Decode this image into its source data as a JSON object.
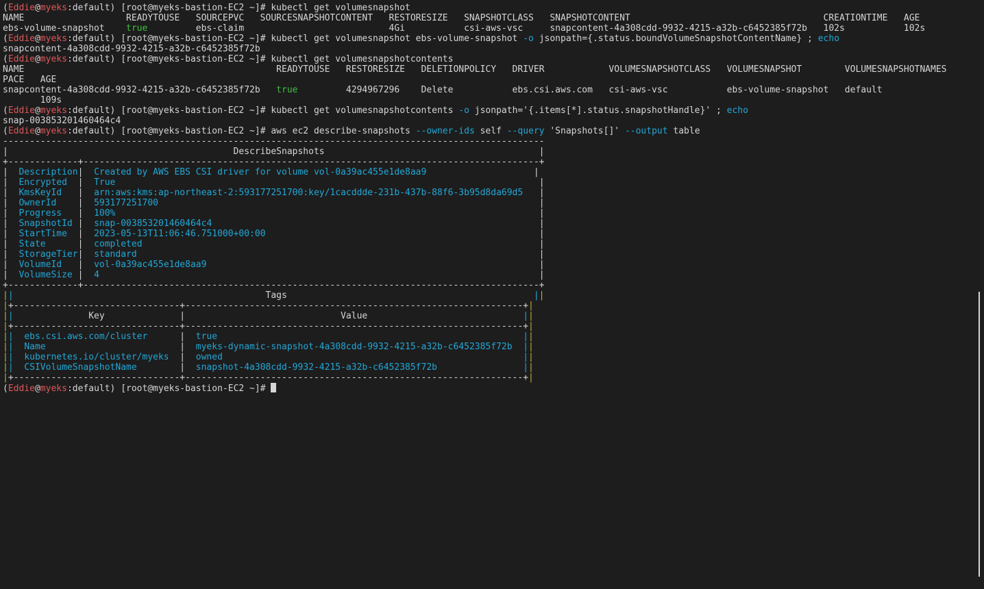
{
  "terminal": {
    "prompt": {
      "user": "Eddie",
      "cluster": "myeks",
      "namespace": "default",
      "host": "[root@myeks-bastion-EC2 ~]#"
    },
    "lines": [
      [
        {
          "t": "(",
          "c": "def"
        },
        {
          "t": "Eddie",
          "c": "red"
        },
        {
          "t": "@",
          "c": "def"
        },
        {
          "t": "myeks",
          "c": "red"
        },
        {
          "t": ":default) [root@myeks-bastion-EC2 ~]# kubectl get volumesnapshot",
          "c": "def"
        }
      ],
      [
        {
          "t": "NAME                   READYTOUSE   SOURCEPVC   SOURCESNAPSHOTCONTENT   RESTORESIZE   SNAPSHOTCLASS   SNAPSHOTCONTENT                                    CREATIONTIME   AGE",
          "c": "def"
        }
      ],
      [
        {
          "t": "ebs-volume-snapshot    ",
          "c": "def"
        },
        {
          "t": "true",
          "c": "green"
        },
        {
          "t": "         ebs-claim                           4Gi           csi-aws-vsc     snapcontent-4a308cdd-9932-4215-a32b-c6452385f72b   102s           102s",
          "c": "def"
        }
      ],
      [
        {
          "t": "(",
          "c": "def"
        },
        {
          "t": "Eddie",
          "c": "red"
        },
        {
          "t": "@",
          "c": "def"
        },
        {
          "t": "myeks",
          "c": "red"
        },
        {
          "t": ":default) [root@myeks-bastion-EC2 ~]# kubectl get volumesnapshot ebs-volume-snapshot ",
          "c": "def"
        },
        {
          "t": "-o",
          "c": "cyan"
        },
        {
          "t": " jsonpath={.status.boundVolumeSnapshotContentName} ; ",
          "c": "def"
        },
        {
          "t": "echo",
          "c": "cyan"
        }
      ],
      [
        {
          "t": "snapcontent-4a308cdd-9932-4215-a32b-c6452385f72b",
          "c": "def"
        }
      ],
      [
        {
          "t": "(",
          "c": "def"
        },
        {
          "t": "Eddie",
          "c": "red"
        },
        {
          "t": "@",
          "c": "def"
        },
        {
          "t": "myeks",
          "c": "red"
        },
        {
          "t": ":default) [root@myeks-bastion-EC2 ~]# kubectl get volumesnapshotcontents",
          "c": "def"
        }
      ],
      [
        {
          "t": "NAME                                               READYTOUSE   RESTORESIZE   DELETIONPOLICY   DRIVER            VOLUMESNAPSHOTCLASS   VOLUMESNAPSHOT        VOLUMESNAPSHOTNAMES",
          "c": "def"
        }
      ],
      [
        {
          "t": "PACE   AGE",
          "c": "def"
        }
      ],
      [
        {
          "t": "snapcontent-4a308cdd-9932-4215-a32b-c6452385f72b   ",
          "c": "def"
        },
        {
          "t": "true",
          "c": "green"
        },
        {
          "t": "         4294967296    Delete           ebs.csi.aws.com   csi-aws-vsc           ebs-volume-snapshot   default",
          "c": "def"
        }
      ],
      [
        {
          "t": "       109s",
          "c": "def"
        }
      ],
      [
        {
          "t": "(",
          "c": "def"
        },
        {
          "t": "Eddie",
          "c": "red"
        },
        {
          "t": "@",
          "c": "def"
        },
        {
          "t": "myeks",
          "c": "red"
        },
        {
          "t": ":default) [root@myeks-bastion-EC2 ~]# kubectl get volumesnapshotcontents ",
          "c": "def"
        },
        {
          "t": "-o",
          "c": "cyan"
        },
        {
          "t": " jsonpath='{.items[*].status.snapshotHandle}' ; ",
          "c": "def"
        },
        {
          "t": "echo",
          "c": "cyan"
        }
      ],
      [
        {
          "t": "snap-003853201460464c4",
          "c": "def"
        }
      ],
      [
        {
          "t": "(",
          "c": "def"
        },
        {
          "t": "Eddie",
          "c": "red"
        },
        {
          "t": "@",
          "c": "def"
        },
        {
          "t": "myeks",
          "c": "red"
        },
        {
          "t": ":default) [root@myeks-bastion-EC2 ~]# aws ec2 describe-snapshots ",
          "c": "def"
        },
        {
          "t": "--owner-ids",
          "c": "cyan"
        },
        {
          "t": " self ",
          "c": "def"
        },
        {
          "t": "--query",
          "c": "cyan"
        },
        {
          "t": " 'Snapshots[]' ",
          "c": "def"
        },
        {
          "t": "--output",
          "c": "cyan"
        },
        {
          "t": " table",
          "c": "def"
        }
      ],
      [
        {
          "t": "-----------------------------------------------------------------------------------------------------",
          "c": "def"
        }
      ],
      [
        {
          "t": "|                                          DescribeSnapshots                                        |",
          "c": "def"
        }
      ],
      [
        {
          "t": "+-------------+-------------------------------------------------------------------------------------+",
          "c": "def"
        }
      ],
      [
        {
          "t": "|  ",
          "c": "def"
        },
        {
          "t": "Description",
          "c": "cyan"
        },
        {
          "t": "|  ",
          "c": "def"
        },
        {
          "t": "Created by AWS EBS CSI driver for volume vol-0a39ac455e1de8aa9",
          "c": "cyan"
        },
        {
          "t": "                    |",
          "c": "def"
        }
      ],
      [
        {
          "t": "|  ",
          "c": "def"
        },
        {
          "t": "Encrypted",
          "c": "cyan"
        },
        {
          "t": "  |  ",
          "c": "def"
        },
        {
          "t": "True",
          "c": "cyan"
        },
        {
          "t": "                                                                               |",
          "c": "def"
        }
      ],
      [
        {
          "t": "|  ",
          "c": "def"
        },
        {
          "t": "KmsKeyId",
          "c": "cyan"
        },
        {
          "t": "   |  ",
          "c": "def"
        },
        {
          "t": "arn:aws:kms:ap-northeast-2:593177251700:key/1cacddde-231b-437b-88f6-3b95d8da69d5",
          "c": "cyan"
        },
        {
          "t": "   |",
          "c": "def"
        }
      ],
      [
        {
          "t": "|  ",
          "c": "def"
        },
        {
          "t": "OwnerId",
          "c": "cyan"
        },
        {
          "t": "    |  ",
          "c": "def"
        },
        {
          "t": "593177251700",
          "c": "cyan"
        },
        {
          "t": "                                                                       |",
          "c": "def"
        }
      ],
      [
        {
          "t": "|  ",
          "c": "def"
        },
        {
          "t": "Progress",
          "c": "cyan"
        },
        {
          "t": "   |  ",
          "c": "def"
        },
        {
          "t": "100%",
          "c": "cyan"
        },
        {
          "t": "                                                                               |",
          "c": "def"
        }
      ],
      [
        {
          "t": "|  ",
          "c": "def"
        },
        {
          "t": "SnapshotId",
          "c": "cyan"
        },
        {
          "t": " |  ",
          "c": "def"
        },
        {
          "t": "snap-003853201460464c4",
          "c": "cyan"
        },
        {
          "t": "                                                             |",
          "c": "def"
        }
      ],
      [
        {
          "t": "|  ",
          "c": "def"
        },
        {
          "t": "StartTime",
          "c": "cyan"
        },
        {
          "t": "  |  ",
          "c": "def"
        },
        {
          "t": "2023-05-13T11:06:46.751000+00:00",
          "c": "cyan"
        },
        {
          "t": "                                                   |",
          "c": "def"
        }
      ],
      [
        {
          "t": "|  ",
          "c": "def"
        },
        {
          "t": "State",
          "c": "cyan"
        },
        {
          "t": "      |  ",
          "c": "def"
        },
        {
          "t": "completed",
          "c": "cyan"
        },
        {
          "t": "                                                                          |",
          "c": "def"
        }
      ],
      [
        {
          "t": "|  ",
          "c": "def"
        },
        {
          "t": "StorageTier",
          "c": "cyan"
        },
        {
          "t": "|  ",
          "c": "def"
        },
        {
          "t": "standard",
          "c": "cyan"
        },
        {
          "t": "                                                                           |",
          "c": "def"
        }
      ],
      [
        {
          "t": "|  ",
          "c": "def"
        },
        {
          "t": "VolumeId",
          "c": "cyan"
        },
        {
          "t": "   |  ",
          "c": "def"
        },
        {
          "t": "vol-0a39ac455e1de8aa9",
          "c": "cyan"
        },
        {
          "t": "                                                              |",
          "c": "def"
        }
      ],
      [
        {
          "t": "|  ",
          "c": "def"
        },
        {
          "t": "VolumeSize",
          "c": "cyan"
        },
        {
          "t": " |  ",
          "c": "def"
        },
        {
          "t": "4",
          "c": "cyan"
        },
        {
          "t": "                                                                                  |",
          "c": "def"
        }
      ],
      [
        {
          "t": "+-------------+-------------------------------------------------------------------------------------+",
          "c": "def"
        }
      ],
      [
        {
          "t": "|",
          "c": "yel"
        },
        {
          "t": "|",
          "c": "cyan"
        },
        {
          "t": "                                               Tags                                              ",
          "c": "def"
        },
        {
          "t": "|",
          "c": "cyan"
        },
        {
          "t": "|",
          "c": "yel"
        }
      ],
      [
        {
          "t": "|",
          "c": "yel"
        },
        {
          "t": "+-------------------------------+---------------------------------------------------------------+",
          "c": "def"
        },
        {
          "t": "|",
          "c": "yel"
        }
      ],
      [
        {
          "t": "|",
          "c": "yel"
        },
        {
          "t": "|",
          "c": "cyan"
        },
        {
          "t": "              Key              |                             Value                             ",
          "c": "def"
        },
        {
          "t": "|",
          "c": "cyan"
        },
        {
          "t": "|",
          "c": "yel"
        }
      ],
      [
        {
          "t": "|",
          "c": "yel"
        },
        {
          "t": "+-------------------------------+---------------------------------------------------------------+",
          "c": "def"
        },
        {
          "t": "|",
          "c": "yel"
        }
      ],
      [
        {
          "t": "|",
          "c": "yel"
        },
        {
          "t": "|",
          "c": "cyan"
        },
        {
          "t": "  ",
          "c": "def"
        },
        {
          "t": "ebs.csi.aws.com/cluster",
          "c": "cyan"
        },
        {
          "t": "      |  ",
          "c": "def"
        },
        {
          "t": "true",
          "c": "cyan"
        },
        {
          "t": "                                                         ",
          "c": "def"
        },
        {
          "t": "|",
          "c": "cyan"
        },
        {
          "t": "|",
          "c": "yel"
        }
      ],
      [
        {
          "t": "|",
          "c": "yel"
        },
        {
          "t": "|",
          "c": "cyan"
        },
        {
          "t": "  ",
          "c": "def"
        },
        {
          "t": "Name",
          "c": "cyan"
        },
        {
          "t": "                         |  ",
          "c": "def"
        },
        {
          "t": "myeks-dynamic-snapshot-4a308cdd-9932-4215-a32b-c6452385f72b",
          "c": "cyan"
        },
        {
          "t": "  ",
          "c": "def"
        },
        {
          "t": "|",
          "c": "cyan"
        },
        {
          "t": "|",
          "c": "yel"
        }
      ],
      [
        {
          "t": "|",
          "c": "yel"
        },
        {
          "t": "|",
          "c": "cyan"
        },
        {
          "t": "  ",
          "c": "def"
        },
        {
          "t": "kubernetes.io/cluster/myeks",
          "c": "cyan"
        },
        {
          "t": "  |  ",
          "c": "def"
        },
        {
          "t": "owned",
          "c": "cyan"
        },
        {
          "t": "                                                        ",
          "c": "def"
        },
        {
          "t": "|",
          "c": "cyan"
        },
        {
          "t": "|",
          "c": "yel"
        }
      ],
      [
        {
          "t": "|",
          "c": "yel"
        },
        {
          "t": "|",
          "c": "cyan"
        },
        {
          "t": "  ",
          "c": "def"
        },
        {
          "t": "CSIVolumeSnapshotName",
          "c": "cyan"
        },
        {
          "t": "        |  ",
          "c": "def"
        },
        {
          "t": "snapshot-4a308cdd-9932-4215-a32b-c6452385f72b",
          "c": "cyan"
        },
        {
          "t": "                ",
          "c": "def"
        },
        {
          "t": "|",
          "c": "cyan"
        },
        {
          "t": "|",
          "c": "yel"
        }
      ],
      [
        {
          "t": "|",
          "c": "yel"
        },
        {
          "t": "+-------------------------------+---------------------------------------------------------------+",
          "c": "def"
        },
        {
          "t": "|",
          "c": "yel"
        }
      ],
      [
        {
          "t": "(",
          "c": "def"
        },
        {
          "t": "Eddie",
          "c": "red"
        },
        {
          "t": "@",
          "c": "def"
        },
        {
          "t": "myeks",
          "c": "red"
        },
        {
          "t": ":default) [root@myeks-bastion-EC2 ~]# ",
          "c": "def"
        }
      ]
    ]
  },
  "colors": {
    "background": "#1d1d1d",
    "foreground": "#d6d6d6",
    "prompt_red": "#e0575a",
    "ok_green": "#3fbf3f",
    "option_cyan": "#22a7d6",
    "border_yellow": "#c4b23a"
  }
}
